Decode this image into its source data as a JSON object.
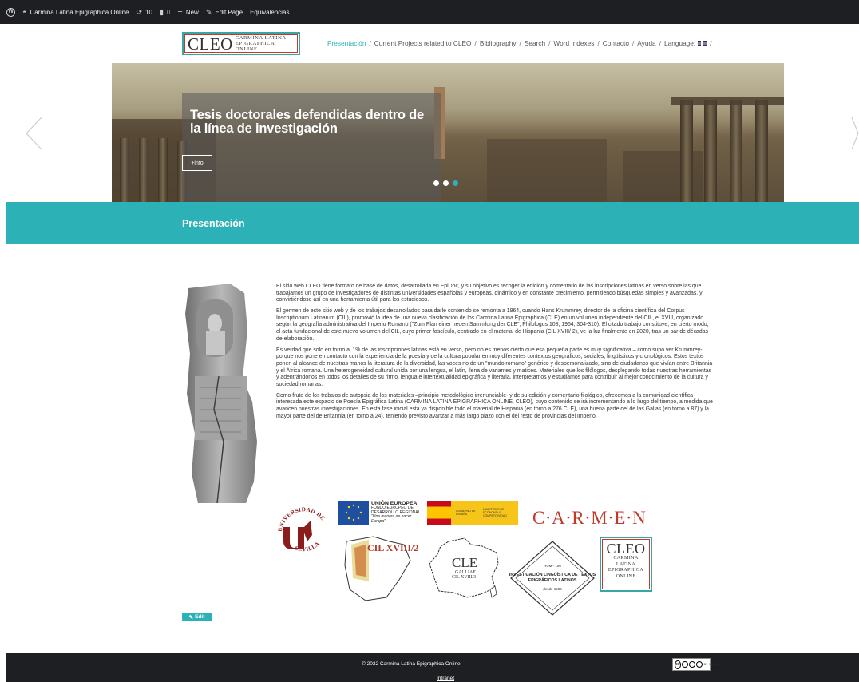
{
  "adminbar": {
    "site_name": "Carmina Latina Epigraphica Online",
    "updates_count": "10",
    "comments_count": "0",
    "new_label": "New",
    "edit_page_label": "Edit Page",
    "equivalencias_label": "Equivalencias"
  },
  "header": {
    "logo_big": "CLEO",
    "logo_line1": "CARMINA LATINA",
    "logo_line2": "EPIGRAPHICA ONLINE",
    "nav": [
      {
        "label": "Presentación",
        "active": true
      },
      {
        "label": "Current Projects related to CLEO",
        "active": false
      },
      {
        "label": "Bibliography",
        "active": false
      },
      {
        "label": "Search",
        "active": false
      },
      {
        "label": "Word Indexes",
        "active": false
      },
      {
        "label": "Contacto",
        "active": false
      },
      {
        "label": "Ayuda",
        "active": false
      },
      {
        "label": "Language:",
        "active": false
      }
    ],
    "nav_separator": "/"
  },
  "slider": {
    "title": "Tesis doctorales defendidas dentro de la línea de investigación",
    "button_label": "+info",
    "slide_count": 3,
    "active_slide": 3
  },
  "band": {
    "title": "Presentación"
  },
  "article": {
    "paragraphs": [
      "El sitio web CLEO tiene formato de base de datos, desarrollada en EpiDoc, y su objetivo es recoger la edición y comentario de las inscripciones latinas en verso sobre las que trabajamos un grupo de investigadores de distintas universidades españolas y europeas, dinámico y en constante crecimiento, permitiendo búsquedas simples y avanzadas, y convirtiéndose así en una herramienta útil para los estudiosos.",
      "El germen de este sitio web y de los trabajos desarrollados para darle contenido se remonta a 1964, cuando Hans Krummrey, director de la oficina científica del Corpus Inscriptionum Latinarum (CIL), promovió la idea de una nueva clasificación de los Carmina Latina Epigraphica (CLE) en un volumen independiente del CIL, el XVIII, organizado según la geografía administrativa del Imperio Romano (\"Zum Plan einer neuen Sammlung der CLE\", Philologus 108, 1964, 304-310). El citado trabajo constituye, en cierto modo, el acta fundacional de este nuevo volumen del CIL, cuyo primer fascículo, centrado en el material de Hispania (CIL XVIII/ 2), ve la luz finalmente en 2020, tras un par de décadas de elaboración.",
      "Es verdad que solo en torno al 1% de las inscripciones latinas está en verso, pero no es menos cierto que esa pequeña parte es muy significativa – como supo ver Krummrey- porque nos pone en contacto con la experiencia de la poesía y de la cultura popular en muy diferentes contextos geográficos, sociales, lingüísticos y cronológicos. Estos textos ponen al alcance de nuestras manos la literatura de la diversidad, las voces no de un \"mundo romano\" genérico y despersonalizado, sino de ciudadanos que vivían entre Britannia y el África romana. Una heterogeneidad cultural unida por una lengua, el latín, llena de variantes y matices. Materiales que los filólogos, desplegando todas nuestras herramientas y adentrándonos en todos los detalles de su ritmo, lengua e intertextualidad epigráfica y literaria, interpretamos y estudiamos para contribuir al mejor conocimiento de la cultura y sociedad romanas.",
      "Como fruto de los trabajos de autopsia de los materiales –principio metodológico irrenunciable- y de su edición y comentario filológico, ofrecemos a la comunidad científica interesada este espacio de Poesía Epigráfica Latina (CARMINA LATINA EPIGRAPHICA ONLINE, CLEO), cuyo contenido se irá incrementando a lo largo del tiempo, a medida que avancen nuestras investigaciones. En esta fase inicial está ya disponible todo el material de Hispania (en torno a 276 CLE), una buena parte del de las Galias (en torno a 87) y la mayor parte del de Britannia (en torno a 24), teniendo previsto avanzar a más largo plazo con el del resto de provincias del Imperio."
    ]
  },
  "logos": {
    "usevilla_top": "UNIVERSIDAD DE",
    "usevilla_bottom": "SEVILLA",
    "ue_title": "UNIÓN EUROPEA",
    "ue_line1": "FONDO EUROPEO DE",
    "ue_line2": "DESARROLLO REGIONAL",
    "ue_line3": "\"Una manera de hacer Europa\"",
    "mineco_line1": "GOBIERNO DE ESPAÑA",
    "mineco_line2": "MINISTERIO DE ECONOMÍA Y COMPETITIVIDAD",
    "carmen": "C·A·R·M·E·N",
    "cil": "CIL XVIII/2",
    "cle_big": "CLE",
    "cle_small1": "GALLIAE",
    "cle_small2": "CIL XVIII/3",
    "hum_code": "HUM - 156",
    "hum_line1": "INVESTIGACIÓN LINGÜÍSTICA DE TEXTOS",
    "hum_line2": "EPIGRÁFICOS LATINOS",
    "hum_since": "desde 1989",
    "cleo_big": "CLEO",
    "cleo_l1": "CARMINA",
    "cleo_l2": "LATINA",
    "cleo_l3": "EPIGRAPHICA",
    "cleo_l4": "ONLINE"
  },
  "edit_label": "Edit",
  "footer": {
    "copyright": "© 2022 Carmina Latina Epigraphica Online",
    "intranet": "Intranet",
    "cc_by": "BY",
    "cc_nc": "NC",
    "cc_nd": "ND"
  },
  "colors": {
    "accent": "#2cb1b7",
    "brand_red": "#c0392b",
    "dark_bar": "#1d1f22"
  }
}
